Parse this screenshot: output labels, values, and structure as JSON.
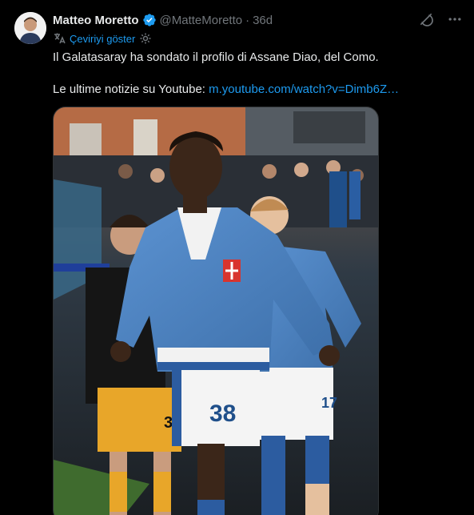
{
  "author": {
    "name": "Matteo Moretto",
    "handle": "@MatteMoretto",
    "separator": "·",
    "time": "36d"
  },
  "translate": {
    "label": "Çeviriyi göster"
  },
  "tweet": {
    "line1": "Il Galatasaray ha sondato il profilo di Assane Diao, del Como.",
    "line2_prefix": "Le ultime notizie su Youtube: ",
    "line2_link": "m.youtube.com/watch?v=Dimb6Z…"
  },
  "media": {
    "player_number_front": "38",
    "player_number_back": "17",
    "player_number_gk": "35"
  },
  "icons": [
    "grok-icon",
    "more-icon",
    "verified-badge-icon",
    "translate-settings-icon"
  ],
  "colors": {
    "accent": "#1d9bf0",
    "jersey": "#4f86c6",
    "background": "#000000"
  }
}
